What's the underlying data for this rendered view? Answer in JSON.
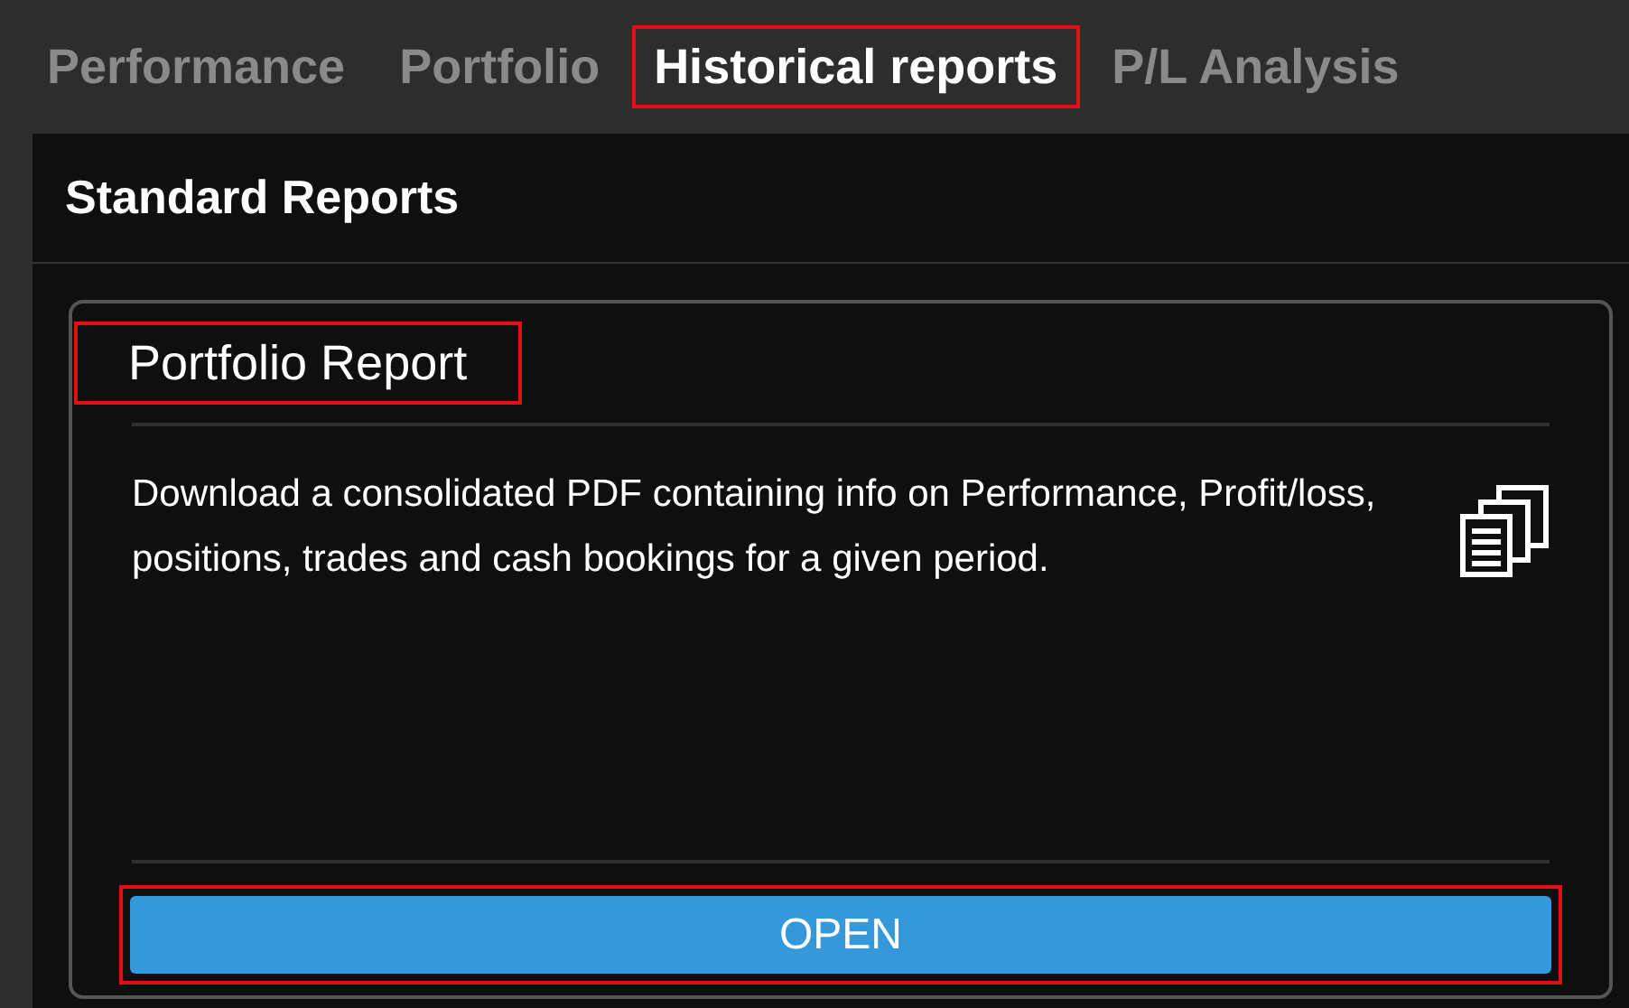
{
  "tabs": [
    {
      "label": "Performance",
      "selected": false,
      "highlighted": false
    },
    {
      "label": "Portfolio",
      "selected": false,
      "highlighted": false
    },
    {
      "label": "Historical reports",
      "selected": true,
      "highlighted": true
    },
    {
      "label": "P/L Analysis",
      "selected": false,
      "highlighted": false
    }
  ],
  "panel": {
    "title": "Standard Reports",
    "card": {
      "title": "Portfolio Report",
      "title_highlighted": true,
      "description": "Download a consolidated PDF containing info on Performance, Profit/loss, positions, trades and cash bookings for a given period.",
      "button": {
        "label": "OPEN",
        "highlighted": true
      }
    }
  }
}
